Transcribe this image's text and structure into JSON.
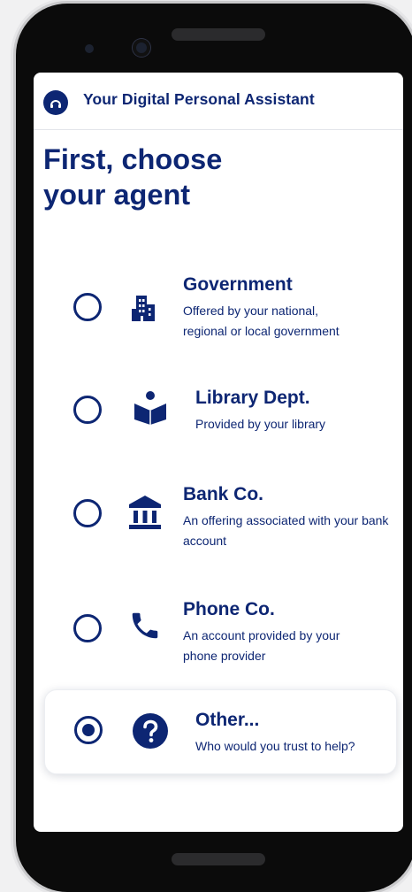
{
  "app": {
    "title": "Your Digital Personal Assistant",
    "logo_icon": "assistant-logo-icon"
  },
  "page": {
    "title_line1": "First, choose",
    "title_line2": "your agent"
  },
  "options": [
    {
      "id": "government",
      "title": "Government",
      "description": "Offered by your national, regional or local government",
      "icon": "government-building-icon",
      "selected": false
    },
    {
      "id": "library",
      "title": "Library Dept.",
      "description": "Provided by your library",
      "icon": "library-reader-icon",
      "selected": false
    },
    {
      "id": "bank",
      "title": "Bank Co.",
      "description": "An offering associated with your bank account",
      "icon": "bank-icon",
      "selected": false
    },
    {
      "id": "phone",
      "title": "Phone Co.",
      "description": "An account provided by your phone provider",
      "icon": "phone-icon",
      "selected": false
    },
    {
      "id": "other",
      "title": "Other...",
      "description": "Who would you trust to help?",
      "icon": "question-icon",
      "selected": true
    }
  ],
  "colors": {
    "primary": "#0d2673",
    "background": "#ffffff",
    "frame": "#0b0b0b"
  }
}
